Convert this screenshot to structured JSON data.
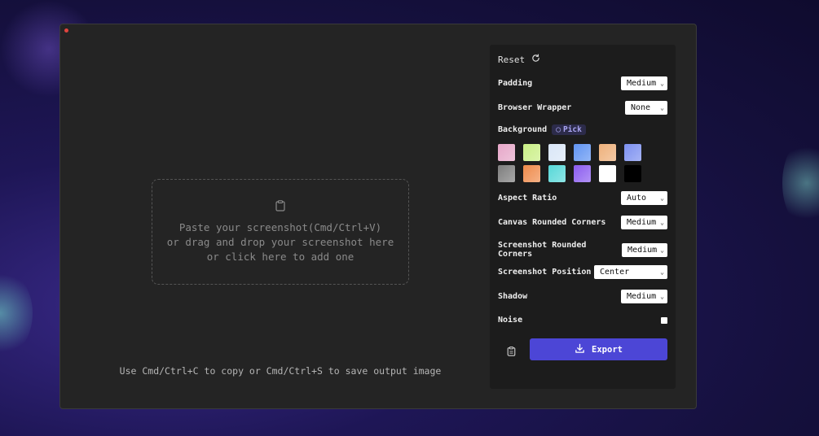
{
  "dropzone": {
    "line1": "Paste your screenshot(Cmd/Ctrl+V)",
    "line2": "or drag and drop your screenshot here",
    "line3": "or click here to add one"
  },
  "hint": "Use Cmd/Ctrl+C to copy or Cmd/Ctrl+S to save output image",
  "panel": {
    "reset_label": "Reset",
    "padding": {
      "label": "Padding",
      "value": "Medium"
    },
    "browser_wrapper": {
      "label": "Browser Wrapper",
      "value": "None"
    },
    "background": {
      "label": "Background",
      "pick_label": "Pick",
      "swatches": [
        "#e6a6c8",
        "#c9ef84",
        "#d9e6f7",
        "#5f93f2",
        "#eeb07a",
        "#7b8ff0",
        "#7d7d7d",
        "#ef8a4a",
        "#56d8d8",
        "#8b5cf0",
        "#ffffff",
        "#000000"
      ]
    },
    "aspect_ratio": {
      "label": "Aspect Ratio",
      "value": "Auto"
    },
    "canvas_rounded_corners": {
      "label": "Canvas Rounded Corners",
      "value": "Medium"
    },
    "screenshot_rounded_corners": {
      "label": "Screenshot Rounded Corners",
      "value": "Medium"
    },
    "screenshot_position": {
      "label": "Screenshot Position",
      "value": "Center"
    },
    "shadow": {
      "label": "Shadow",
      "value": "Medium"
    },
    "noise": {
      "label": "Noise",
      "checked": false
    },
    "export_label": "Export"
  },
  "colors": {
    "accent": "#4c46d6",
    "close": "#e0443e",
    "panel_bg": "#1c1c1c",
    "window_bg": "#242424"
  }
}
